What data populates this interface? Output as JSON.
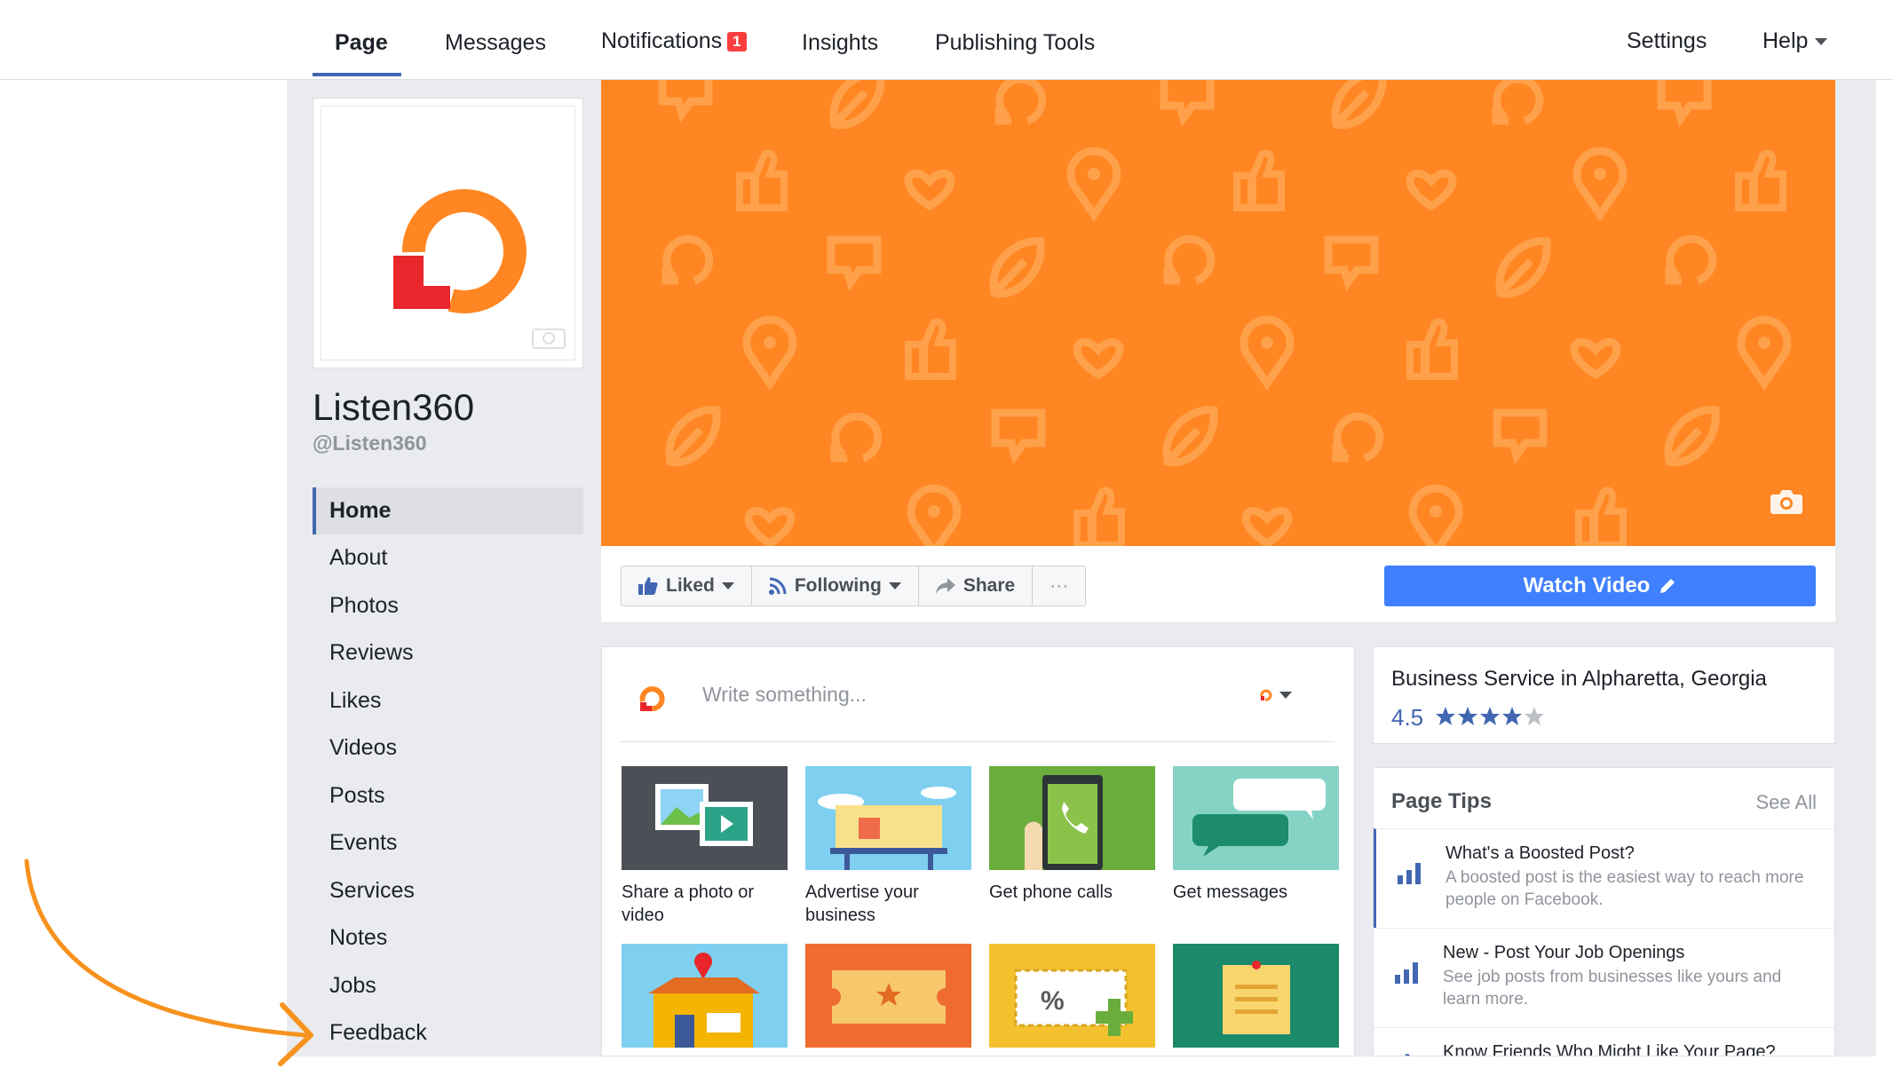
{
  "nav": {
    "page": "Page",
    "messages": "Messages",
    "notifications": "Notifications",
    "notifications_count": "1",
    "insights": "Insights",
    "publishing_tools": "Publishing Tools",
    "settings": "Settings",
    "help": "Help"
  },
  "profile": {
    "name": "Listen360",
    "handle": "@Listen360"
  },
  "sidebar": {
    "items": [
      {
        "label": "Home"
      },
      {
        "label": "About"
      },
      {
        "label": "Photos"
      },
      {
        "label": "Reviews"
      },
      {
        "label": "Likes"
      },
      {
        "label": "Videos"
      },
      {
        "label": "Posts"
      },
      {
        "label": "Events"
      },
      {
        "label": "Services"
      },
      {
        "label": "Notes"
      },
      {
        "label": "Jobs"
      },
      {
        "label": "Feedback"
      }
    ]
  },
  "actions": {
    "liked": "Liked",
    "following": "Following",
    "share": "Share",
    "more": "···",
    "watch_video": "Watch Video"
  },
  "composer": {
    "placeholder": "Write something...",
    "tiles": [
      {
        "label": "Share a photo or video"
      },
      {
        "label": "Advertise your business"
      },
      {
        "label": "Get phone calls"
      },
      {
        "label": "Get messages"
      }
    ]
  },
  "info": {
    "category": "Business Service in Alpharetta, Georgia",
    "rating": "4.5",
    "stars": 4.5
  },
  "tips": {
    "title": "Page Tips",
    "see_all": "See All",
    "items": [
      {
        "title": "What's a Boosted Post?",
        "desc": "A boosted post is the easiest way to reach more people on Facebook."
      },
      {
        "title": "New - Post Your Job Openings",
        "desc": "See job posts from businesses like yours and learn more."
      },
      {
        "title": "Know Friends Who Might Like Your Page?",
        "desc": ""
      }
    ]
  },
  "colors": {
    "accent": "#4267b2",
    "brand_orange": "#ff8622",
    "cta_blue": "#4080ff",
    "logo_red": "#e8262b",
    "arrow_orange": "#f7921e"
  },
  "icons": [
    "camera-icon",
    "like-icon",
    "rss-icon",
    "share-icon",
    "pencil-icon",
    "boost-icon"
  ]
}
